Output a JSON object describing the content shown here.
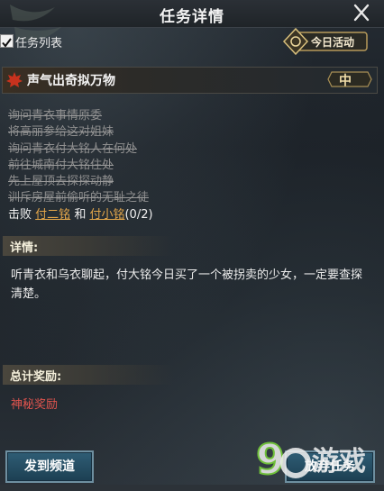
{
  "window": {
    "title": "任务详情"
  },
  "list_toggle": {
    "label": "任务列表",
    "checked": true
  },
  "daily_button": {
    "label": "今日活动"
  },
  "quest": {
    "name": "声气出奇拟万物",
    "difficulty": "中",
    "steps_done": [
      "询问青衣事情原委",
      "将高丽参给这对姐妹",
      "询问青衣付大铭人在何处",
      "前往城南付大铭住处",
      "先上屋顶去探探动静",
      "训斥房屋前偷听的无耻之徒"
    ],
    "current": {
      "prefix": "击败",
      "target1": "付二铭",
      "joiner": "和",
      "target2": "付小铭",
      "progress": "(0/2)"
    }
  },
  "details": {
    "header": "详情:",
    "text": "听青衣和乌衣聊起，付大铭今日买了一个被拐卖的少女，一定要查探清楚。"
  },
  "rewards": {
    "header": "总计奖励:",
    "item": "神秘奖励"
  },
  "buttons": {
    "send_channel": "发到频道",
    "abandon": "放弃任务"
  },
  "watermark": {
    "text": "9游戏"
  },
  "colors": {
    "link": "#e3a64a",
    "reward": "#e0544e",
    "button": "#2f5d75"
  }
}
